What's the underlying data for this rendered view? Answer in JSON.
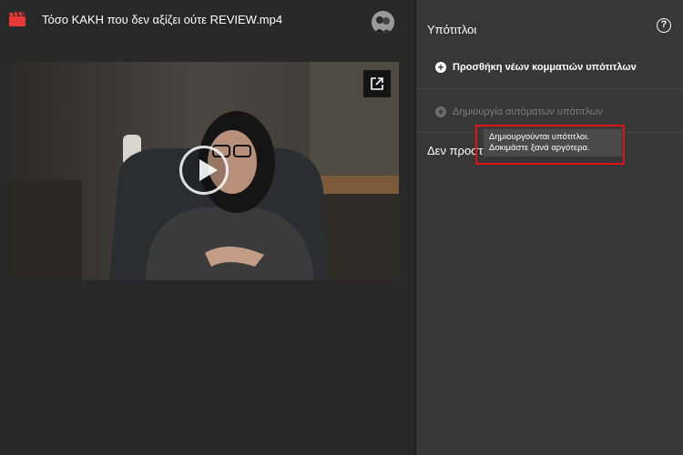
{
  "header": {
    "video_title": "Τόσο ΚΑΚΗ που δεν αξίζει ούτε REVIEW.mp4",
    "icon": "clapperboard-icon",
    "brand_color": "#e53935"
  },
  "player": {
    "play_icon": "play-icon",
    "external_icon": "open-in-new-icon"
  },
  "subtitles_panel": {
    "title": "Υπότιτλοι",
    "help_glyph": "?",
    "add_label": "Προσθήκη νέων κομματιών υπότιτλων",
    "add_glyph": "+",
    "auto_label": "Δημιουργία αυτόματων υπότιτλων",
    "auto_glyph": "+",
    "status_text": "Δεν προστέ",
    "tooltip": {
      "line1": "Δημιουργούνται υπότιτλοι.",
      "line2": "Δοκιμάστε ξανά αργότερα."
    },
    "highlight_color": "#e01414"
  }
}
